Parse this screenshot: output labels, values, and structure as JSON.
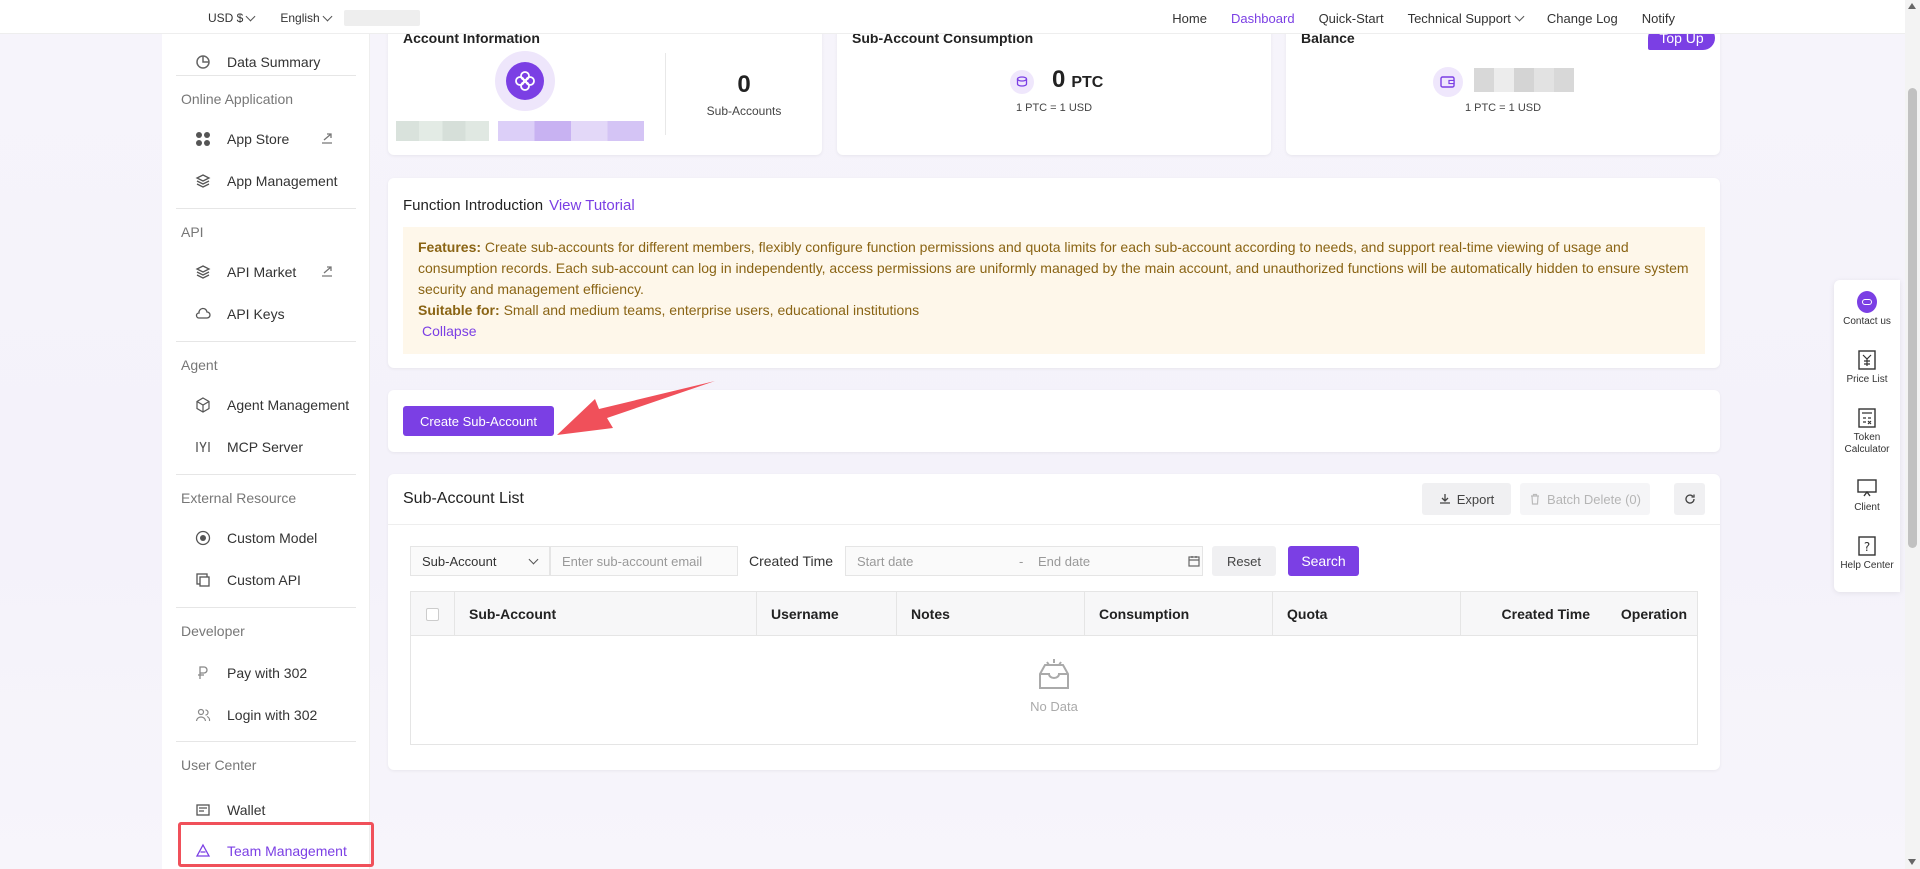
{
  "topbar": {
    "currency": "USD $",
    "language": "English",
    "nav": [
      "Home",
      "Dashboard",
      "Quick-Start",
      "Technical Support",
      "Change Log",
      "Notify"
    ]
  },
  "sidebar": {
    "data_summary": "Data Summary",
    "groups": {
      "online": "Online Application",
      "api": "API",
      "agent": "Agent",
      "external": "External Resource",
      "developer": "Developer",
      "user_center": "User Center"
    },
    "items": {
      "app_store": "App Store",
      "app_management": "App Management",
      "api_market": "API Market",
      "api_keys": "API Keys",
      "agent_management": "Agent Management",
      "mcp_server": "MCP Server",
      "custom_model": "Custom Model",
      "custom_api": "Custom API",
      "pay_with_302": "Pay with 302",
      "login_with_302": "Login with 302",
      "wallet": "Wallet",
      "team_management": "Team Management"
    }
  },
  "account": {
    "title": "Account Information",
    "sub_count": "0",
    "sub_label": "Sub-Accounts"
  },
  "consumption": {
    "title": "Sub-Account Consumption",
    "value": "0",
    "unit": "PTC",
    "rate": "1 PTC = 1 USD"
  },
  "balance": {
    "title": "Balance",
    "topup": "Top Up",
    "rate": "1 PTC = 1 USD"
  },
  "intro": {
    "title": "Function Introduction",
    "tutorial": "View Tutorial",
    "features_label": "Features:",
    "features_text": "Create sub-accounts for different members, flexibly configure function permissions and quota limits for each sub-account according to needs, and support real-time viewing of usage and consumption records. Each sub-account can log in independently, access permissions are uniformly managed by the main account, and unauthorized functions will be automatically hidden to ensure system security and management efficiency.",
    "suitable_label": "Suitable for:",
    "suitable_text": "Small and medium teams, enterprise users, educational institutions",
    "collapse": "Collapse"
  },
  "create_button": "Create Sub-Account",
  "list": {
    "title": "Sub-Account List",
    "export": "Export",
    "batch_delete": "Batch Delete (0)",
    "filter_select": "Sub-Account",
    "email_placeholder": "Enter sub-account email",
    "created_time_label": "Created Time",
    "start_placeholder": "Start date",
    "range_sep": "-",
    "end_placeholder": "End date",
    "reset": "Reset",
    "search": "Search",
    "columns": [
      "Sub-Account",
      "Username",
      "Notes",
      "Consumption",
      "Quota",
      "Created Time",
      "Operation"
    ],
    "empty": "No Data"
  },
  "dock": [
    "Contact us",
    "Price List",
    "Token Calculator",
    "Client",
    "Help Center"
  ],
  "colors": {
    "accent": "#7b3fe4",
    "highlight": "#f0505a",
    "notice_bg": "#fef7ea",
    "notice_text": "#8a6414"
  }
}
